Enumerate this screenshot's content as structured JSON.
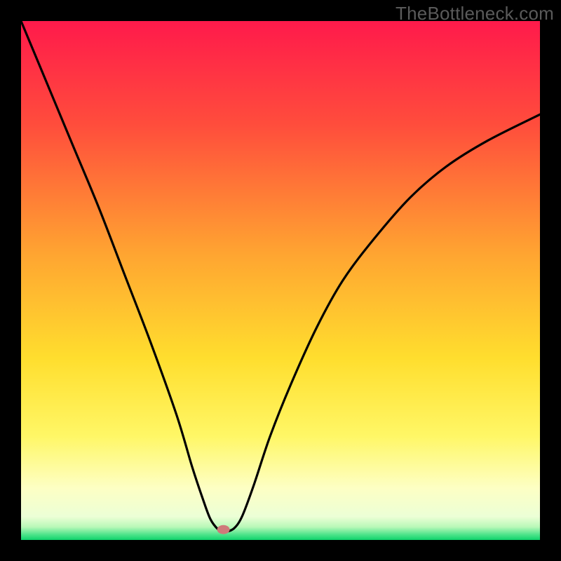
{
  "watermark": "TheBottleneck.com",
  "chart_data": {
    "type": "line",
    "title": "",
    "xlabel": "",
    "ylabel": "",
    "xlim": [
      0,
      100
    ],
    "ylim": [
      0,
      100
    ],
    "gradient_stops": [
      {
        "offset": 0,
        "color": "#ff1a4b"
      },
      {
        "offset": 0.2,
        "color": "#ff4d3c"
      },
      {
        "offset": 0.45,
        "color": "#ffa531"
      },
      {
        "offset": 0.65,
        "color": "#ffde2e"
      },
      {
        "offset": 0.8,
        "color": "#fff766"
      },
      {
        "offset": 0.9,
        "color": "#fdffc4"
      },
      {
        "offset": 0.955,
        "color": "#ecffd6"
      },
      {
        "offset": 0.975,
        "color": "#b8f8b8"
      },
      {
        "offset": 0.99,
        "color": "#4be38a"
      },
      {
        "offset": 1.0,
        "color": "#0fd36b"
      }
    ],
    "marker": {
      "x": 39,
      "y": 2,
      "color": "#cf7a7a"
    },
    "series": [
      {
        "name": "curve",
        "points": [
          {
            "x": 0,
            "y": 100
          },
          {
            "x": 5,
            "y": 88
          },
          {
            "x": 10,
            "y": 76
          },
          {
            "x": 15,
            "y": 64
          },
          {
            "x": 20,
            "y": 51
          },
          {
            "x": 25,
            "y": 38
          },
          {
            "x": 30,
            "y": 24
          },
          {
            "x": 33,
            "y": 14
          },
          {
            "x": 35,
            "y": 8
          },
          {
            "x": 36.5,
            "y": 4
          },
          {
            "x": 38,
            "y": 2
          },
          {
            "x": 39,
            "y": 1.6
          },
          {
            "x": 40,
            "y": 1.7
          },
          {
            "x": 41,
            "y": 2.2
          },
          {
            "x": 42,
            "y": 3.4
          },
          {
            "x": 43,
            "y": 5.5
          },
          {
            "x": 45,
            "y": 11
          },
          {
            "x": 48,
            "y": 20
          },
          {
            "x": 52,
            "y": 30
          },
          {
            "x": 57,
            "y": 41
          },
          {
            "x": 62,
            "y": 50
          },
          {
            "x": 68,
            "y": 58
          },
          {
            "x": 75,
            "y": 66
          },
          {
            "x": 82,
            "y": 72
          },
          {
            "x": 90,
            "y": 77
          },
          {
            "x": 100,
            "y": 82
          }
        ]
      }
    ]
  }
}
